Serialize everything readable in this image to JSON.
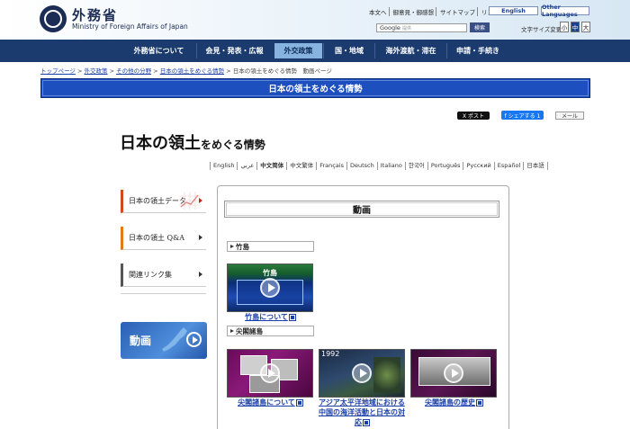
{
  "header": {
    "logo_jp": "外務省",
    "logo_en": "Ministry of Foreign Affairs of Japan",
    "top_links": [
      "本文へ",
      "御意見・御感想",
      "サイトマップ",
      "リンク集"
    ],
    "lang_english": "English",
    "lang_other": "Other Languages",
    "search_prefix": "Google",
    "search_placeholder": "提供",
    "search_button": "検索",
    "font_size_label": "文字サイズ変更",
    "font_sizes": [
      "小",
      "中",
      "大"
    ],
    "font_size_selected": "中"
  },
  "nav": {
    "items": [
      "外務省について",
      "会見・発表・広報",
      "外交政策",
      "国・地域",
      "海外渡航・滞在",
      "申請・手続き"
    ],
    "active": "外交政策"
  },
  "breadcrumb": {
    "items": [
      "トップページ",
      "外交政策",
      "その他の分野",
      "日本の領土をめぐる情勢"
    ],
    "current": "日本の領土をめぐる情勢　動画ページ",
    "separator": ">"
  },
  "banner": {
    "title": "日本の領土をめぐる情勢"
  },
  "share": {
    "x": "X ポスト",
    "facebook": "f シェアする 1",
    "mail": "メール"
  },
  "page_title": {
    "big": "日本の領土",
    "small_1": "をめぐる",
    "big_2": "情勢"
  },
  "languages": [
    "English",
    "عربي",
    "中文简体",
    "中文繁体",
    "Français",
    "Deutsch",
    "Italiano",
    "한국어",
    "Português",
    "Русский",
    "Español",
    "日本語"
  ],
  "sidebar": {
    "items": [
      {
        "label": "日本の領土データ"
      },
      {
        "label": "日本の領土 Q&A"
      },
      {
        "label": "関連リンク集"
      }
    ],
    "video_banner": "動画"
  },
  "main": {
    "title": "動画",
    "sections": [
      {
        "heading": "竹島",
        "videos": [
          {
            "link": "竹島について",
            "thumb_caption": "竹島"
          }
        ]
      },
      {
        "heading": "尖閣諸島",
        "videos": [
          {
            "link": "尖閣諸島について"
          },
          {
            "link": "アジア太平洋地域における中国の海洋活動と日本の対応",
            "thumb_caption": "1992"
          },
          {
            "link": "尖閣諸島の歴史"
          }
        ]
      }
    ]
  },
  "colors": {
    "nav_bg": "#1b3b6f",
    "nav_active": "#86b3df",
    "banner": "#1d4fbe",
    "link": "#1a3fa8"
  }
}
